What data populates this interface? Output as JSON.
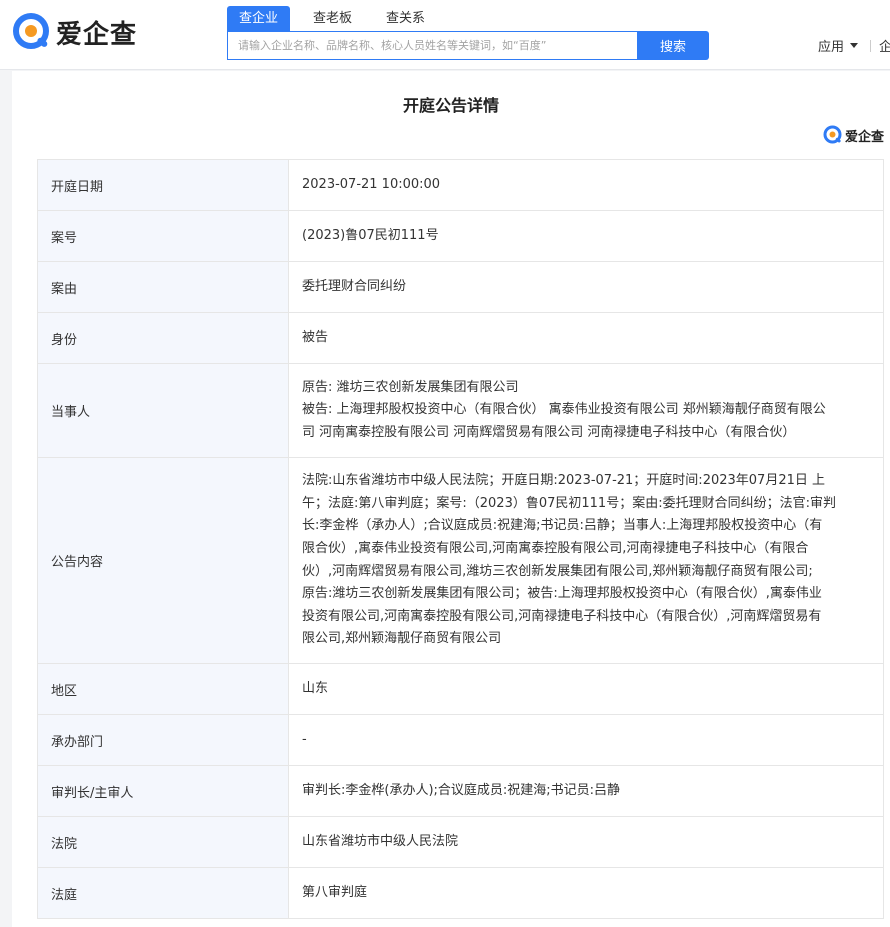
{
  "header": {
    "logo_text": "爱企查",
    "search_tabs": [
      {
        "label": "查企业",
        "active": true
      },
      {
        "label": "查老板",
        "active": false
      },
      {
        "label": "查关系",
        "active": false
      }
    ],
    "search_placeholder": "请输入企业名称、品牌名称、核心人员姓名等关键词，如“百度”",
    "search_button": "搜索",
    "app_menu": "应用",
    "right_cut": "企",
    "colors": {
      "accent": "#2f7bf5",
      "logo_orange": "#f59a23"
    }
  },
  "page": {
    "title": "开庭公告详情",
    "watermark": "爱企查"
  },
  "details": [
    {
      "label": "开庭日期",
      "value": "2023-07-21 10:00:00"
    },
    {
      "label": "案号",
      "value": "(2023)鲁07民初111号"
    },
    {
      "label": "案由",
      "value": "委托理财合同纠纷"
    },
    {
      "label": "身份",
      "value": "被告"
    },
    {
      "label": "当事人",
      "lines": [
        "原告: 潍坊三农创新发展集团有限公司",
        "被告: 上海理邦股权投资中心（有限合伙） 寓泰伟业投资有限公司 郑州颖海靓仔商贸有限公",
        "司 河南寓泰控股有限公司 河南辉熠贸易有限公司 河南禄捷电子科技中心（有限合伙）"
      ]
    },
    {
      "label": "公告内容",
      "lines": [
        "法院:山东省潍坊市中级人民法院；开庭日期:2023-07-21；开庭时间:2023年07月21日 上",
        "午；法庭:第八审判庭；案号:（2023）鲁07民初111号；案由:委托理财合同纠纷；法官:审判",
        "长:李金桦（承办人）;合议庭成员:祝建海;书记员:吕静；当事人:上海理邦股权投资中心（有",
        "限合伙）,寓泰伟业投资有限公司,河南寓泰控股有限公司,河南禄捷电子科技中心（有限合",
        "伙）,河南辉熠贸易有限公司,潍坊三农创新发展集团有限公司,郑州颖海靓仔商贸有限公司;",
        "原告:潍坊三农创新发展集团有限公司；被告:上海理邦股权投资中心（有限合伙）,寓泰伟业",
        "投资有限公司,河南寓泰控股有限公司,河南禄捷电子科技中心（有限合伙）,河南辉熠贸易有",
        "限公司,郑州颖海靓仔商贸有限公司"
      ]
    },
    {
      "label": "地区",
      "value": "山东"
    },
    {
      "label": "承办部门",
      "value": "-"
    },
    {
      "label": "审判长/主审人",
      "value": "审判长:李金桦(承办人);合议庭成员:祝建海;书记员:吕静"
    },
    {
      "label": "法院",
      "value": "山东省潍坊市中级人民法院"
    },
    {
      "label": "法庭",
      "value": "第八审判庭"
    }
  ]
}
